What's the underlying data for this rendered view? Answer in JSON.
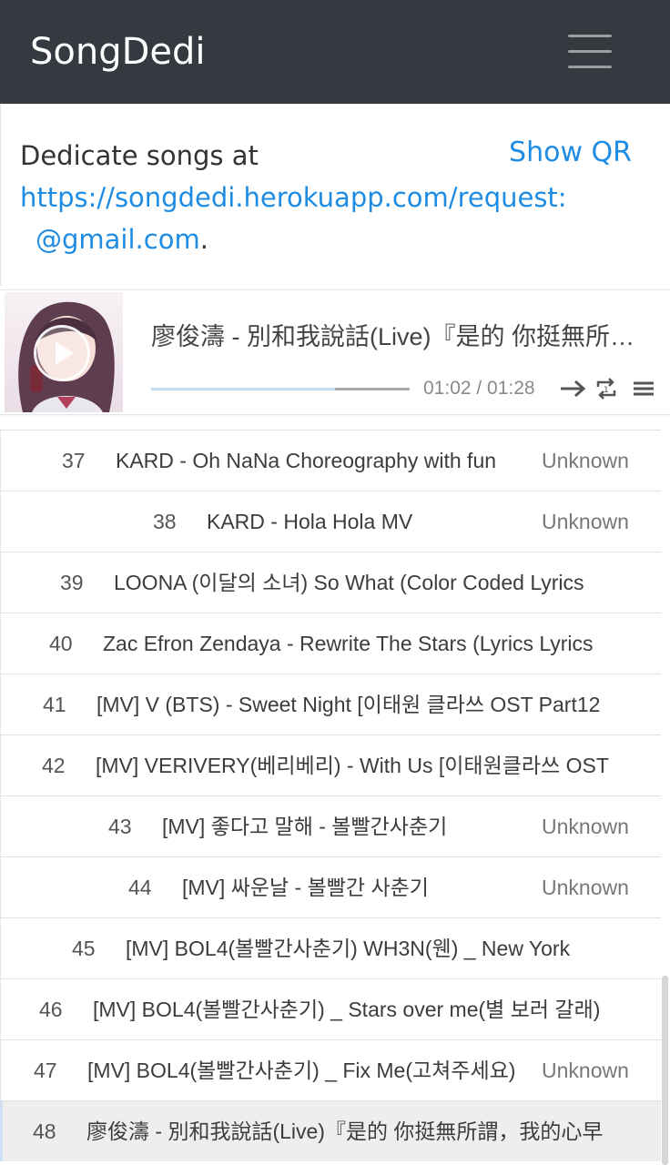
{
  "navbar": {
    "brand": "SongDedi",
    "menu_icon": "hamburger-icon"
  },
  "info": {
    "line1": "Dedicate songs at",
    "url": "https://songdedi.herokuapp.com/request:",
    "email": "@gmail.com",
    "email_suffix": ".",
    "show_qr": "Show QR"
  },
  "player": {
    "title": "廖俊濤 - 別和我說話(Live)『是的 你挺無所謂，我的心早",
    "progress": 0.71,
    "time": "01:02 / 01:28",
    "icons": [
      "next-arrow-icon",
      "repeat-icon",
      "playlist-icon"
    ]
  },
  "playlist": [
    {
      "num": "37",
      "title": "KARD - Oh NaNa Choreography with fun",
      "artist": "Unknown"
    },
    {
      "num": "38",
      "title": "KARD - Hola Hola MV",
      "artist": "Unknown"
    },
    {
      "num": "39",
      "title": "LOONA (이달의 소녀) So What (Color Coded Lyrics",
      "artist": ""
    },
    {
      "num": "40",
      "title": "Zac Efron Zendaya - Rewrite The Stars (Lyrics Lyrics",
      "artist": ""
    },
    {
      "num": "41",
      "title": "[MV] V (BTS) - Sweet Night [이태원 클라쓰 OST Part12",
      "artist": ""
    },
    {
      "num": "42",
      "title": "[MV] VERIVERY(베리베리) - With Us [이태원클라쓰 OST",
      "artist": ""
    },
    {
      "num": "43",
      "title": "[MV] 좋다고 말해 - 볼빨간사춘기",
      "artist": "Unknown"
    },
    {
      "num": "44",
      "title": "[MV] 싸운날 - 볼빨간 사춘기",
      "artist": "Unknown"
    },
    {
      "num": "45",
      "title": "[MV] BOL4(볼빨간사춘기) WH3N(웬) _ New York",
      "artist": ""
    },
    {
      "num": "46",
      "title": "[MV] BOL4(볼빨간사춘기) _ Stars over me(별 보러 갈래)",
      "artist": ""
    },
    {
      "num": "47",
      "title": "[MV] BOL4(볼빨간사춘기) _ Fix Me(고쳐주세요)",
      "artist": "Unknown"
    },
    {
      "num": "48",
      "title": "廖俊濤 - 別和我說話(Live)『是的 你挺無所謂，我的心早",
      "artist": ""
    }
  ]
}
